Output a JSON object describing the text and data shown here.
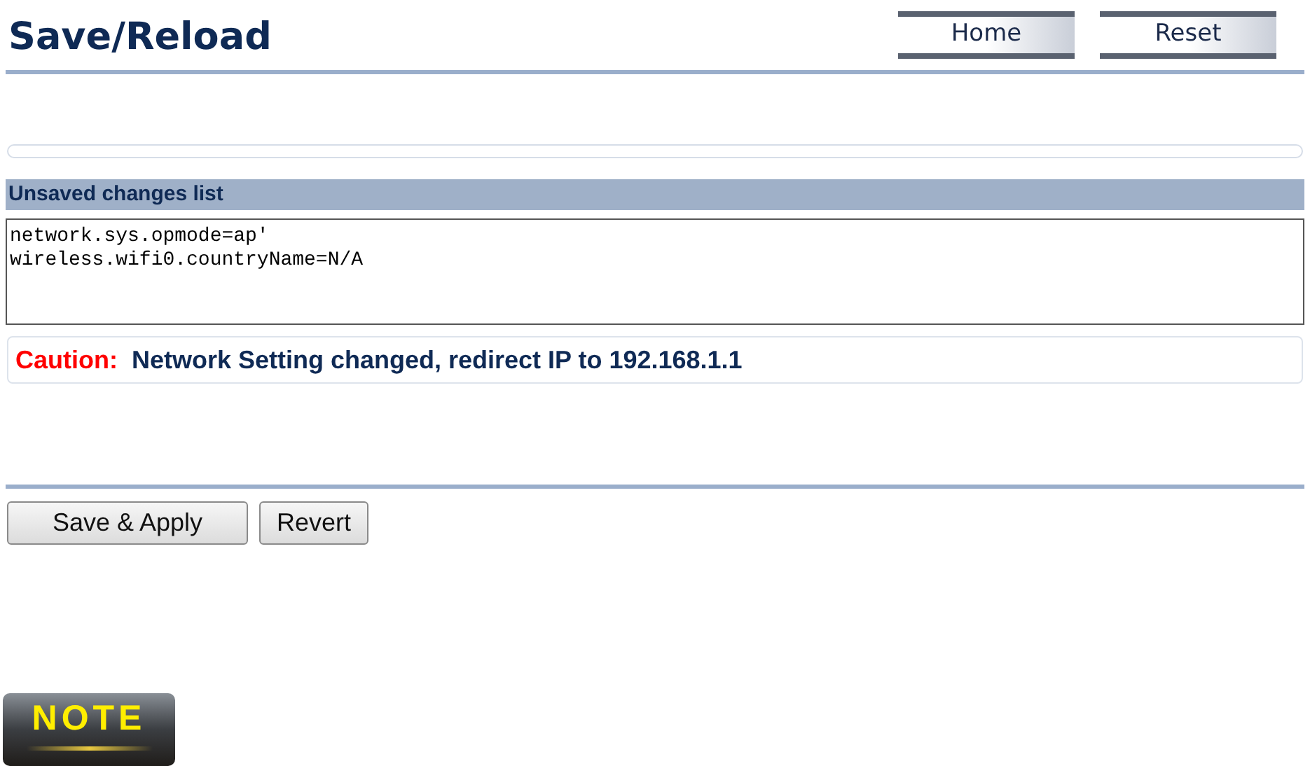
{
  "page_title": "Save/Reload",
  "nav_buttons": [
    "Home",
    "Reset"
  ],
  "changes_panel": {
    "title": "Unsaved changes list",
    "lines": [
      "network.sys.opmode=ap'",
      "wireless.wifi0.countryName=N/A"
    ]
  },
  "caution": {
    "label": "Caution:",
    "message": "Network Setting changed, redirect IP to 192.168.1.1"
  },
  "actions": [
    "Save & Apply",
    "Revert"
  ],
  "note_badge": "NOTE"
}
